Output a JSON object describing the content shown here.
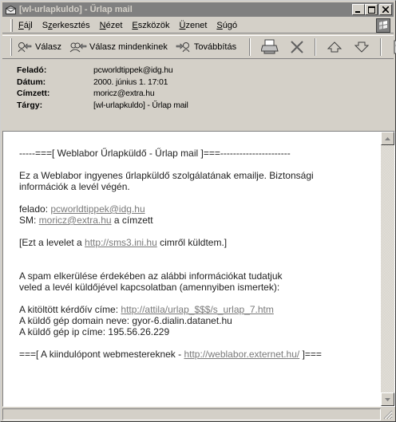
{
  "window": {
    "title": "[wl-urlapkuldo] - Űrlap mail",
    "buttons": {
      "minimize": "_",
      "maximize": "□",
      "close": "×"
    }
  },
  "menu": {
    "items": [
      {
        "label": "Fájl",
        "access": "F"
      },
      {
        "label": "Szerkesztés",
        "access": "z"
      },
      {
        "label": "Nézet",
        "access": "N"
      },
      {
        "label": "Eszközök",
        "access": "E"
      },
      {
        "label": "Üzenet",
        "access": "Ü"
      },
      {
        "label": "Súgó",
        "access": "S"
      }
    ]
  },
  "toolbar": {
    "reply_label": "Válasz",
    "reply_all_label": "Válasz mindenkinek",
    "forward_label": "Továbbítás",
    "icons": [
      "reply-icon",
      "reply-all-icon",
      "forward-icon",
      "print-icon",
      "delete-icon",
      "previous-icon",
      "next-icon",
      "address-book-icon"
    ]
  },
  "header": {
    "from_label": "Feladó:",
    "from_value": "pcworldtippek@idg.hu",
    "date_label": "Dátum:",
    "date_value": "2000. június 1. 17:01",
    "to_label": "Címzett:",
    "to_value": "moricz@extra.hu",
    "subject_label": "Tárgy:",
    "subject_value": "[wl-urlapkuldo] - Űrlap mail"
  },
  "message": {
    "banner": "-----===[ Weblabor Űrlapküldő - Űrlap mail ]===----------------------",
    "intro_line1": "Ez a Weblabor ingyenes űrlapküldő szolgálatának emailje. Biztonsági",
    "intro_line2": "információk a levél végén.",
    "felado_prefix": "felado: ",
    "felado_link": "pcworldtippek@idg.hu",
    "sm_prefix": "SM: ",
    "sm_link": "moricz@extra.hu",
    "sm_suffix": " a címzett",
    "sent_prefix": "[Ezt a levelet a ",
    "sent_link": "http://sms3.ini.hu",
    "sent_suffix": " cimről küldtem.]",
    "spam_line1": "A spam elkerülése érdekében az alábbi információkat tudatjuk",
    "spam_line2": "veled a levél küldőjével kapcsolatban (amennyiben ismertek):",
    "form_prefix": "A kitöltött kérdőív címe: ",
    "form_link": "http://attila/urlap_$$$/s_urlap_7.htm",
    "domain_line": "A küldő gép domain neve: gyor-6.dialin.datanet.hu",
    "ip_line": "A küldő gép ip címe: 195.56.26.229",
    "footer_prefix": "===[ A kiindulópont webmestereknek - ",
    "footer_link": "http://weblabor.externet.hu/",
    "footer_suffix": " ]==="
  }
}
